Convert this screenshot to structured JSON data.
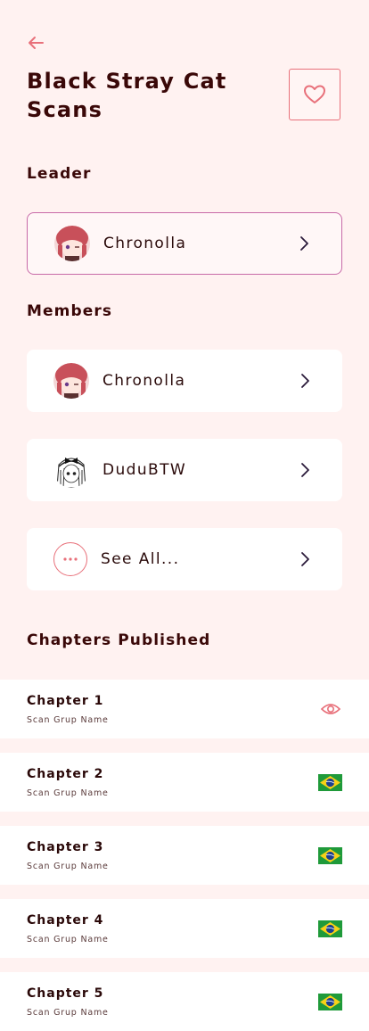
{
  "header": {
    "title": "Black Stray Cat Scans"
  },
  "sections": {
    "leader": "Leader",
    "members": "Members",
    "chapters": "Chapters Published"
  },
  "leader": {
    "name": "Chronolla"
  },
  "members": [
    {
      "name": "Chronolla"
    },
    {
      "name": "DuduBTW"
    }
  ],
  "see_all": "See All...",
  "chapters": [
    {
      "title": "Chapter 1",
      "group": "Scan Grup Name",
      "status": "eye-icon"
    },
    {
      "title": "Chapter 2",
      "group": "Scan Grup Name",
      "status": "brazil-flag-icon"
    },
    {
      "title": "Chapter 3",
      "group": "Scan Grup Name",
      "status": "brazil-flag-icon"
    },
    {
      "title": "Chapter 4",
      "group": "Scan Grup Name",
      "status": "brazil-flag-icon"
    },
    {
      "title": "Chapter 5",
      "group": "Scan Grup Name",
      "status": "brazil-flag-icon"
    }
  ],
  "colors": {
    "accent": "#e8707a",
    "background": "#fff2f1",
    "text": "#3a0a0a",
    "leader_border": "#c86aa8"
  }
}
